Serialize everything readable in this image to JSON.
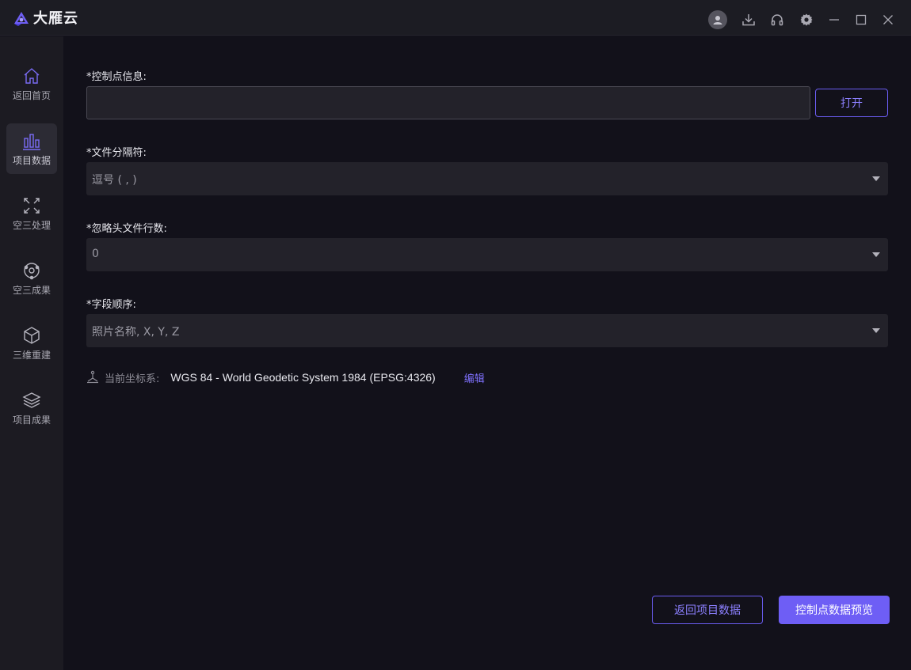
{
  "app": {
    "title": "大雁云"
  },
  "titlebar": {
    "icons": [
      "user-avatar-icon",
      "download-icon",
      "headset-icon",
      "settings-gear-icon",
      "minimize-icon",
      "maximize-icon",
      "close-icon"
    ]
  },
  "sidebar": {
    "items": [
      {
        "label": "返回首页",
        "icon": "home-icon",
        "active": false
      },
      {
        "label": "项目数据",
        "icon": "bar-chart-icon",
        "active": true
      },
      {
        "label": "空三处理",
        "icon": "aerotriangulation-icon",
        "active": false
      },
      {
        "label": "空三成果",
        "icon": "orbit-result-icon",
        "active": false
      },
      {
        "label": "三维重建",
        "icon": "cube-icon",
        "active": false
      },
      {
        "label": "项目成果",
        "icon": "layers-icon",
        "active": false
      }
    ]
  },
  "form": {
    "control_point_label": "*控制点信息:",
    "control_point_value": "",
    "open_button": "打开",
    "separator_label": "*文件分隔符:",
    "separator_value": "逗号 ( , )",
    "skip_rows_label": "*忽略头文件行数:",
    "skip_rows_value": "0",
    "field_order_label": "*字段顺序:",
    "field_order_value": "照片名称, X, Y, Z",
    "coord_label": "当前坐标系:",
    "coord_value": "WGS 84 - World Geodetic System 1984 (EPSG:4326)",
    "coord_edit": "编辑"
  },
  "footer": {
    "back_button": "返回项目数据",
    "preview_button": "控制点数据预览"
  },
  "colors": {
    "accent": "#6e5ef5",
    "background": "#12111a",
    "sidebar": "#1c1b22"
  }
}
